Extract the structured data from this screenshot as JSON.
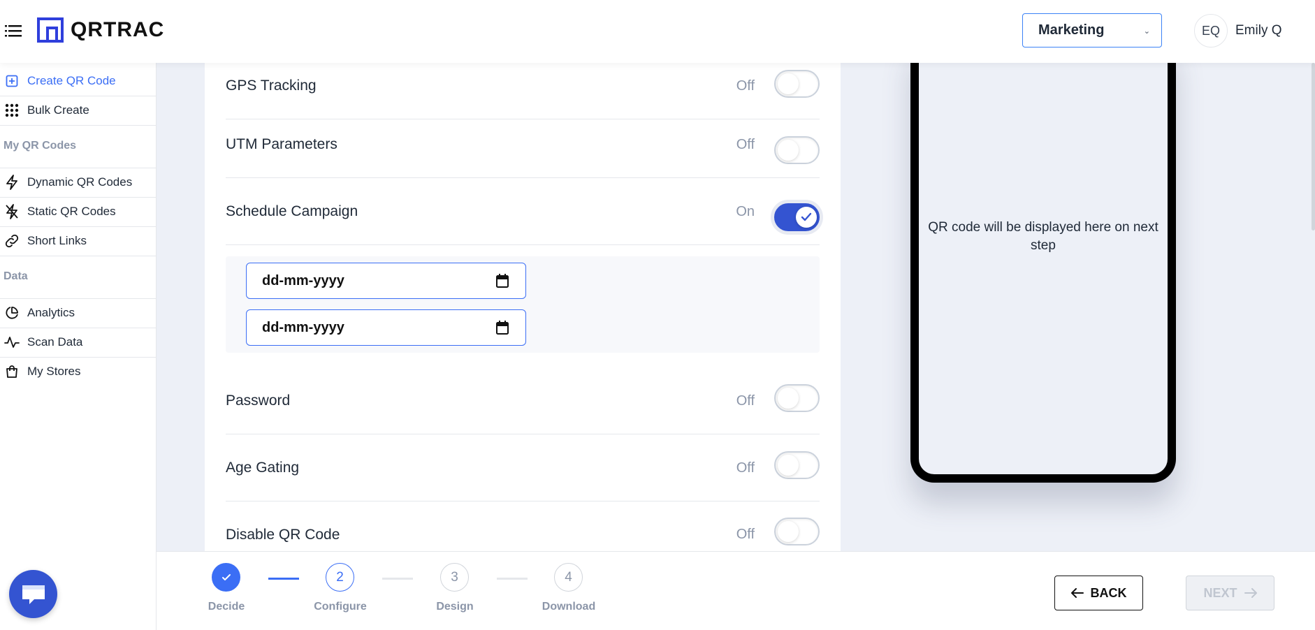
{
  "header": {
    "app_name": "QRTRAC",
    "workspace": "Marketing",
    "user_initials": "EQ",
    "user_name": "Emily Q"
  },
  "sidebar": {
    "items": [
      {
        "label": "Create QR Code",
        "icon": "plus-square-icon",
        "active": true
      },
      {
        "label": "Bulk Create",
        "icon": "grid-dots-icon"
      }
    ],
    "section_qr": "My QR Codes",
    "qr_items": [
      {
        "label": "Dynamic QR Codes",
        "icon": "lightning-icon"
      },
      {
        "label": "Static QR Codes",
        "icon": "lightning-off-icon"
      },
      {
        "label": "Short Links",
        "icon": "link-icon"
      }
    ],
    "section_data": "Data",
    "data_items": [
      {
        "label": "Analytics",
        "icon": "pie-chart-icon"
      },
      {
        "label": "Scan Data",
        "icon": "activity-icon"
      },
      {
        "label": "My Stores",
        "icon": "shopping-bag-icon"
      }
    ]
  },
  "settings": [
    {
      "label": "GPS Tracking",
      "state": "Off",
      "on": false
    },
    {
      "label": "UTM Parameters",
      "state": "Off",
      "on": false
    },
    {
      "label": "Schedule Campaign",
      "state": "On",
      "on": true
    },
    {
      "label": "Password",
      "state": "Off",
      "on": false
    },
    {
      "label": "Age Gating",
      "state": "Off",
      "on": false
    },
    {
      "label": "Disable QR Code",
      "state": "Off",
      "on": false
    }
  ],
  "schedule": {
    "start_placeholder": "dd-mm-yyyy",
    "end_placeholder": "dd-mm-yyyy"
  },
  "preview": {
    "text": "QR code will be displayed here on next step"
  },
  "stepper": {
    "steps": [
      {
        "number": "",
        "label": "Decide",
        "status": "done"
      },
      {
        "number": "2",
        "label": "Configure",
        "status": "current"
      },
      {
        "number": "3",
        "label": "Design",
        "status": "upcoming"
      },
      {
        "number": "4",
        "label": "Download",
        "status": "upcoming"
      }
    ]
  },
  "footer": {
    "back_label": "BACK",
    "next_label": "NEXT"
  },
  "colors": {
    "accent": "#3b6ef5",
    "toggle_on": "#3454d1",
    "background": "#edf0f7"
  }
}
